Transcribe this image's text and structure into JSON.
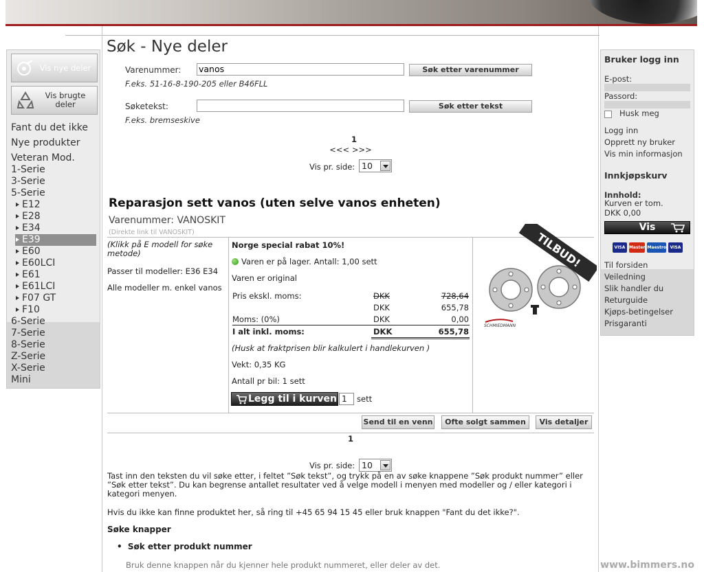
{
  "search": {
    "title": "Søk - Nye deler",
    "part_label": "Varenummer:",
    "part_value": "vanos",
    "part_button": "Søk etter varenummer",
    "part_hint": "F.eks. 51-16-8-190-205 eller B46FLL",
    "text_label": "Søketekst:",
    "text_value": "",
    "text_button": "Søk etter tekst",
    "text_hint": "F.eks. bremseskive"
  },
  "pagination_top": {
    "page": "1",
    "nav": "<<< >>>",
    "per_page_label": "Vis pr. side:",
    "per_page_value": "10"
  },
  "sidebar": {
    "btn_new": "Vis nye deler",
    "btn_used": "Vis brugte deler",
    "links": [
      "Fant du det ikke",
      "Nye produkter",
      "Veteran Mod."
    ],
    "series": [
      "1-Serie",
      "3-Serie",
      "5-Serie"
    ],
    "models": [
      "E12",
      "E28",
      "E34",
      "E39",
      "E60",
      "E60LCI",
      "E61",
      "E61LCI",
      "F07 GT",
      "F10"
    ],
    "selected_model": "E39",
    "series_bottom": [
      "6-Serie",
      "7-Serie",
      "8-Serie",
      "Z-Serie",
      "X-Serie",
      "Mini"
    ]
  },
  "product": {
    "title": "Reparasjon sett vanos (uten selve vanos enheten)",
    "part_number": "Varenummer: VANOSKIT",
    "direct_link": "(Direkte link til VANOSKIT)",
    "click_hint": "(Klikk på E modell for søke metode)",
    "fits": "Passer til modeller: E36 E34",
    "all_models": "Alle modeller m. enkel vanos",
    "discount": "Norge special rabat 10%!",
    "stock": "Varen er på lager. Antall: 1,00 sett",
    "original": "Varen er original",
    "price_ex_label": "Pris ekskl. moms:",
    "currency": "DKK",
    "price_old": "728,64",
    "price_new": "655,78",
    "vat_label": "Moms: (0%)",
    "vat_value": "0,00",
    "total_label": "I alt inkl. moms:",
    "total_value": "655,78",
    "freight_note": "(Husk at fraktprisen blir kalkulert i handlekurven )",
    "weight": "Vekt: 0,35 KG",
    "per_car": "Antall pr bil: 1 sett",
    "cart_button": "Legg til i kurven",
    "qty": "1",
    "qty_unit": "sett",
    "badge": "TILBUD!",
    "brand": "SCHMIEDMANN"
  },
  "actions": {
    "send": "Send til en venn",
    "often": "Ofte solgt sammen",
    "details": "Vis detaljer"
  },
  "pagination_bottom": {
    "page": "1",
    "per_page_label": "Vis pr. side:",
    "per_page_value": "10"
  },
  "help": {
    "p1": "Tast inn den teksten du vil søke etter, i feltet ”Søk tekst”, og trykk på en av søke knappene ”Søk produkt nummer” eller ”Søk etter tekst”. Du kan begrense antallet resultater ved å velge modell i menyen med modeller og / eller kategori i kategori menyen.",
    "p2": "Hvis du ikke kan finne produktet her, så ring til +45 65 94 15 45 eller bruk knappen \"Fant du det ikke?\".",
    "h": "Søke knapper",
    "bullet": "Søk etter produkt nummer",
    "sub": "Bruk denne knappen når du kjenner hele produkt nummeret, eller deler av det."
  },
  "login": {
    "title": "Bruker logg inn",
    "email": "E-post:",
    "password": "Passord:",
    "remember": "Husk meg",
    "links": [
      "Logg inn",
      "Opprett ny bruker",
      "Vis min informasjon"
    ]
  },
  "cart": {
    "title": "Innkjøpskurv",
    "content_label": "Innhold:",
    "empty": "Kurven er tom.",
    "total": "DKK 0,00",
    "show": "Vis",
    "cards": [
      "VISA",
      "Master",
      "Maestro",
      "VISA"
    ]
  },
  "info_links": [
    "Til forsiden",
    "Veiledning",
    "Slik handler du",
    "Returguide",
    "Kjøps-betingelser",
    "Prisgaranti"
  ],
  "watermark": "www.bimmers.no"
}
